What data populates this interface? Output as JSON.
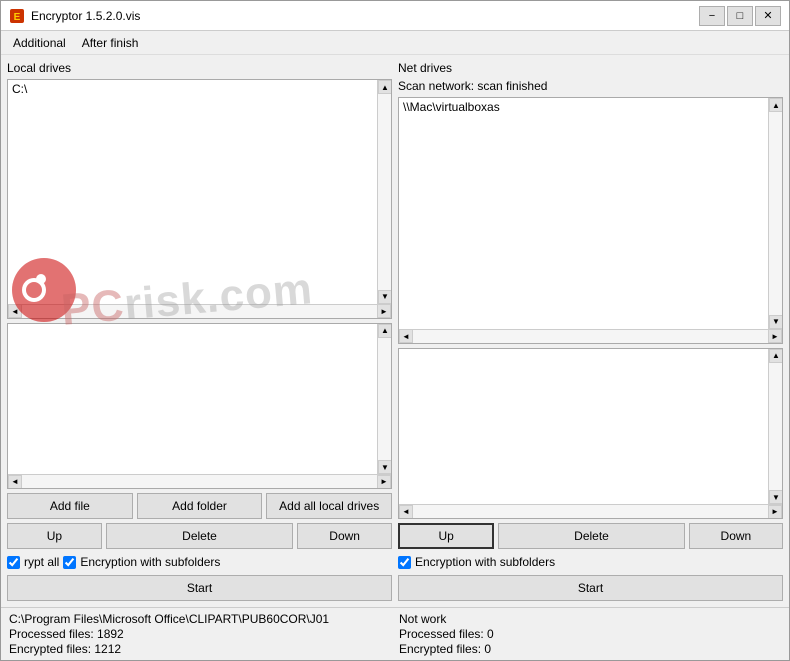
{
  "window": {
    "title": "Encryptor 1.5.2.0.vis",
    "minimize_label": "−",
    "maximize_label": "□",
    "close_label": "✕"
  },
  "menu": {
    "items": [
      {
        "id": "additional",
        "label": "Additional"
      },
      {
        "id": "after_finish",
        "label": "After finish"
      }
    ]
  },
  "left_panel": {
    "label": "Local drives",
    "listbox_top_content": "C:\\",
    "listbox_bottom_content": "",
    "buttons": {
      "add_file": "Add file",
      "add_folder": "Add folder",
      "add_all_local": "Add all local drives",
      "up": "Up",
      "delete": "Delete",
      "down": "Down",
      "start": "Start"
    },
    "encrypt_all_label": "rypt all",
    "encryption_subfolders_label": "Encryption with subfolders",
    "encrypt_all_checked": true,
    "encryption_subfolders_checked": true
  },
  "right_panel": {
    "label": "Net drives",
    "scan_label": "Scan network: scan finished",
    "listbox_top_content": "\\\\Mac\\virtualboxas",
    "listbox_bottom_content": "",
    "buttons": {
      "up": "Up",
      "delete": "Delete",
      "down": "Down",
      "start": "Start"
    },
    "encryption_subfolders_label": "Encryption with subfolders",
    "encryption_subfolders_checked": true
  },
  "status": {
    "left": {
      "line1": "C:\\Program Files\\Microsoft Office\\CLIPART\\PUB60COR\\J01",
      "line2": "Processed files: 1892",
      "line3": "Encrypted files: 1212"
    },
    "right": {
      "line1": "Not work",
      "line2": "Processed files: 0",
      "line3": "Encrypted files: 0"
    }
  },
  "watermark": {
    "text": "risk.com",
    "prefix": "PC"
  }
}
